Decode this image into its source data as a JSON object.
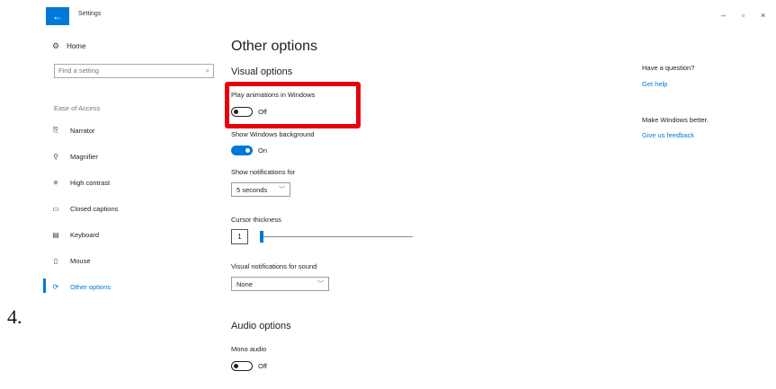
{
  "window": {
    "title": "Settings",
    "back_glyph": "←",
    "controls": {
      "minimize": "–",
      "maximize": "▫",
      "close": "×"
    }
  },
  "sidebar": {
    "home_label": "Home",
    "search_placeholder": "Find a setting",
    "section_label": "Ease of Access",
    "items": [
      {
        "label": "Narrator",
        "icon": "narrator-icon"
      },
      {
        "label": "Magnifier",
        "icon": "magnifier-icon"
      },
      {
        "label": "High contrast",
        "icon": "high-contrast-icon"
      },
      {
        "label": "Closed captions",
        "icon": "closed-captions-icon"
      },
      {
        "label": "Keyboard",
        "icon": "keyboard-icon"
      },
      {
        "label": "Mouse",
        "icon": "mouse-icon"
      },
      {
        "label": "Other options",
        "icon": "other-options-icon",
        "active": true
      }
    ]
  },
  "list_marker": "4.",
  "main": {
    "page_title": "Other options",
    "visual_options_title": "Visual options",
    "play_animations": {
      "label": "Play animations in Windows",
      "state": "Off"
    },
    "show_background": {
      "label": "Show Windows background",
      "state": "On"
    },
    "notifications": {
      "label": "Show notifications for",
      "value": "5 seconds"
    },
    "cursor_thickness": {
      "label": "Cursor thickness",
      "value": "1"
    },
    "visual_notifications": {
      "label": "Visual notifications for sound",
      "value": "None"
    },
    "audio_options_title": "Audio options",
    "mono_audio": {
      "label": "Mono audio",
      "state": "Off"
    }
  },
  "help": {
    "question": "Have a question?",
    "get_help": "Get help",
    "improve": "Make Windows better.",
    "feedback": "Give us feedback"
  },
  "colors": {
    "accent": "#0078d7",
    "highlight": "#e8000b"
  }
}
